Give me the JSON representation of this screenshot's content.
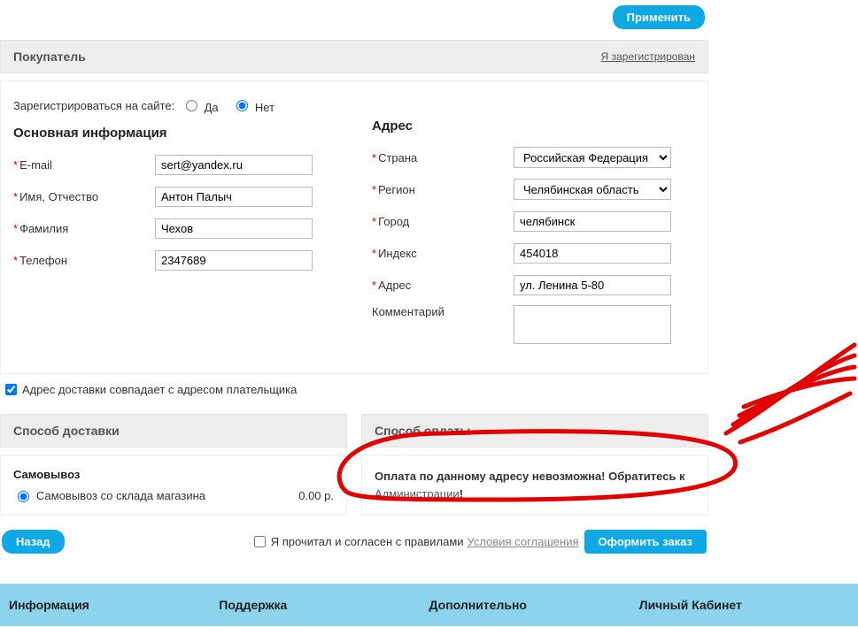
{
  "topButton": "Применить",
  "buyer": {
    "title": "Покупатель",
    "registeredLink": "Я зарегистрирован"
  },
  "register": {
    "label": "Зарегистрироваться на сайте:",
    "yes": "Да",
    "no": "Нет",
    "selected": "no"
  },
  "mainInfo": {
    "heading": "Основная информация",
    "fields": {
      "email": {
        "label": "E-mail",
        "value": "sert@yandex.ru",
        "required": true
      },
      "name": {
        "label": "Имя, Отчество",
        "value": "Антон Палыч",
        "required": true
      },
      "surname": {
        "label": "Фамилия",
        "value": "Чехов",
        "required": true
      },
      "phone": {
        "label": "Телефон",
        "value": "2347689",
        "required": true
      }
    }
  },
  "address": {
    "heading": "Адрес",
    "fields": {
      "country": {
        "label": "Страна",
        "value": "Российская Федерация",
        "required": true
      },
      "region": {
        "label": "Регион",
        "value": "Челябинская область",
        "required": true
      },
      "city": {
        "label": "Город",
        "value": "челябинск",
        "required": true
      },
      "index": {
        "label": "Индекс",
        "value": "454018",
        "required": true
      },
      "addr": {
        "label": "Адрес",
        "value": "ул. Ленина 5-80",
        "required": true
      },
      "comment": {
        "label": "Комментарий",
        "value": "",
        "required": false
      }
    }
  },
  "sameAddress": {
    "label": "Адрес доставки совпадает с адресом плательщика",
    "checked": true
  },
  "shipping": {
    "heading": "Способ доставки",
    "groupTitle": "Самовывоз",
    "optionLabel": "Самовывоз со склада магазина",
    "price": "0.00 р.",
    "selected": true
  },
  "payment": {
    "heading": "Способ оплаты",
    "message": "Оплата по данному адресу невозможна! Обратитесь к ",
    "adminLink": "Администрации",
    "suffix": "!"
  },
  "bottom": {
    "back": "Назад",
    "agreeText": "Я прочитал и согласен с правилами",
    "termsLink": "Условия соглашения",
    "checkout": "Оформить заказ",
    "agreeChecked": false
  },
  "footer": {
    "col1": "Информация",
    "col2": "Поддержка",
    "col3": "Дополнительно",
    "col4": "Личный Кабинет"
  },
  "asterisk": "*"
}
